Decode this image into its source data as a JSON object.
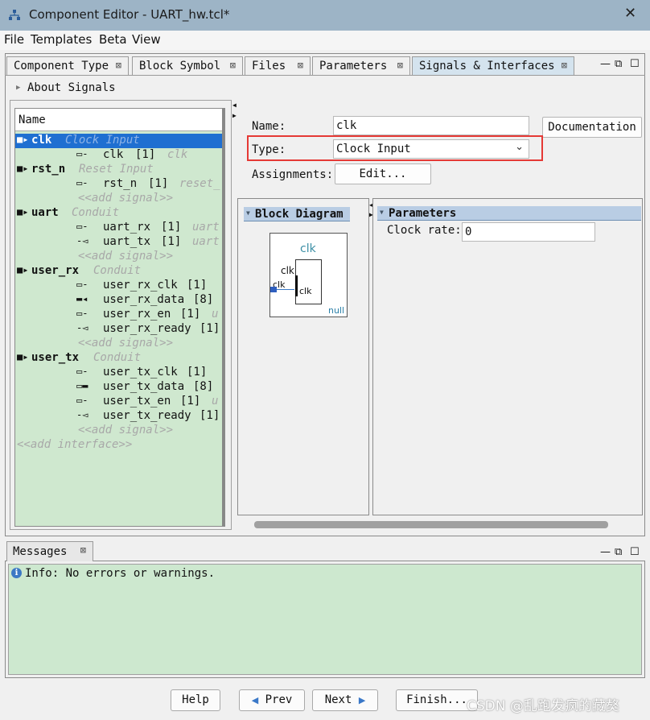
{
  "window": {
    "title": "Component Editor - UART_hw.tcl*",
    "close_glyph": "✕"
  },
  "menu": {
    "file": "File",
    "templates": "Templates",
    "beta": "Beta",
    "view": "View"
  },
  "tabs": [
    {
      "label": "Component Type"
    },
    {
      "label": "Block Symbol"
    },
    {
      "label": "Files"
    },
    {
      "label": "Parameters"
    },
    {
      "label": "Signals & Interfaces"
    }
  ],
  "tab_close_glyph": "⊠",
  "view_buttons": {
    "minimize": "—",
    "restore": "⧉",
    "maximize": "☐"
  },
  "about": {
    "label": "About Signals"
  },
  "tree": {
    "header": "Name",
    "interfaces": [
      {
        "name": "clk",
        "type": "Clock Input",
        "selected": true,
        "signals": [
          {
            "icon": "input",
            "name": "clk",
            "width": "[1]",
            "role": "clk"
          }
        ]
      },
      {
        "name": "rst_n",
        "type": "Reset Input",
        "signals": [
          {
            "icon": "input",
            "name": "rst_n",
            "width": "[1]",
            "role": "reset_"
          }
        ]
      },
      {
        "name": "uart",
        "type": "Conduit",
        "signals": [
          {
            "icon": "input",
            "name": "uart_rx",
            "width": "[1]",
            "role": "uart"
          },
          {
            "icon": "output",
            "name": "uart_tx",
            "width": "[1]",
            "role": "uart"
          }
        ]
      },
      {
        "name": "user_rx",
        "type": "Conduit",
        "signals": [
          {
            "icon": "input",
            "name": "user_rx_clk",
            "width": "[1]",
            "role": ""
          },
          {
            "icon": "bus-out",
            "name": "user_rx_data",
            "width": "[8]",
            "role": ""
          },
          {
            "icon": "input",
            "name": "user_rx_en",
            "width": "[1]",
            "role": "u"
          },
          {
            "icon": "output",
            "name": "user_rx_ready",
            "width": "[1]",
            "role": ""
          }
        ]
      },
      {
        "name": "user_tx",
        "type": "Conduit",
        "signals": [
          {
            "icon": "input",
            "name": "user_tx_clk",
            "width": "[1]",
            "role": ""
          },
          {
            "icon": "bus-in",
            "name": "user_tx_data",
            "width": "[8]",
            "role": ""
          },
          {
            "icon": "input",
            "name": "user_tx_en",
            "width": "[1]",
            "role": "u"
          },
          {
            "icon": "output",
            "name": "user_tx_ready",
            "width": "[1]",
            "role": ""
          }
        ]
      }
    ],
    "add_signal": "<<add signal>>",
    "add_interface": "<<add interface>>"
  },
  "form": {
    "name_label": "Name:",
    "name_value": "clk",
    "type_label": "Type:",
    "type_value": "Clock Input",
    "assignments_label": "Assignments:",
    "edit_button": "Edit...",
    "documentation_button": "Documentation"
  },
  "block_diagram": {
    "title": "Block Diagram",
    "component_name": "clk",
    "port_label_top": "clk",
    "port_label_left": "clk",
    "port_label_inner": "clk",
    "footer": "null"
  },
  "parameters_panel": {
    "title": "Parameters",
    "clock_rate_label": "Clock rate:",
    "clock_rate_value": "0"
  },
  "messages": {
    "tab_label": "Messages",
    "info_text": "Info: No errors or warnings."
  },
  "buttons": {
    "help": "Help",
    "prev": "Prev",
    "next": "Next",
    "finish": "Finish..."
  },
  "watermark": "CSDN @乱跑发疯的藏獒",
  "colors": {
    "selection": "#1f6fd1",
    "highlight_box": "#e53935",
    "panel_green": "#cfe8cf",
    "section_header": "#b9cde4"
  }
}
